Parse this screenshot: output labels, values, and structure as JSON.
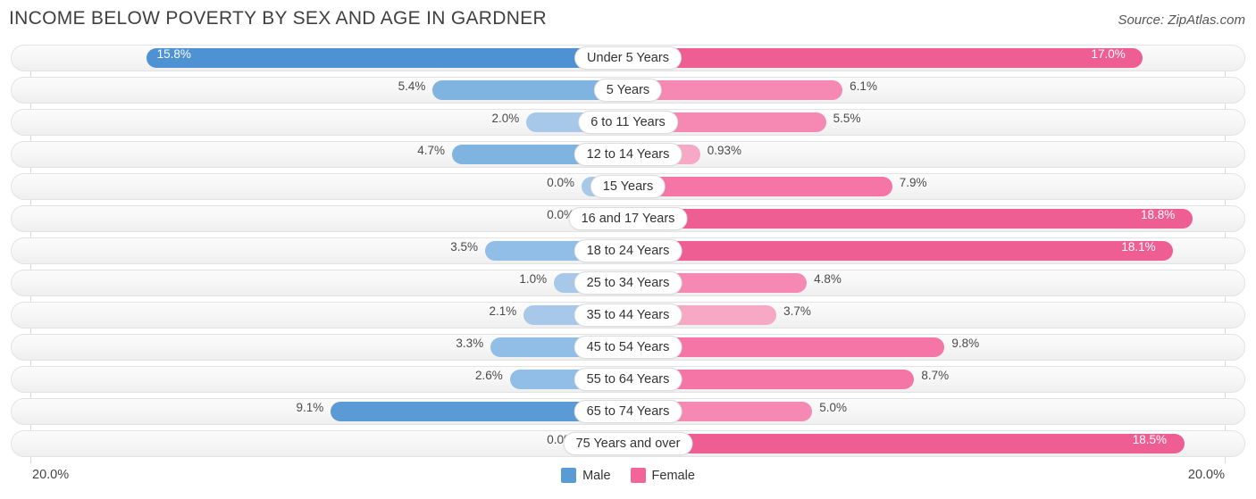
{
  "header": {
    "title": "INCOME BELOW POVERTY BY SEX AND AGE IN GARDNER",
    "source": "Source: ZipAtlas.com"
  },
  "footer": {
    "axis_left": "20.0%",
    "axis_right": "20.0%"
  },
  "legend": {
    "items": [
      {
        "label": "Male",
        "color": "#5b9bd5"
      },
      {
        "label": "Female",
        "color": "#f2649a"
      }
    ]
  },
  "chart_data": {
    "type": "bar",
    "subtype": "diverging-bar",
    "title": "INCOME BELOW POVERTY BY SEX AND AGE IN GARDNER",
    "xlabel": "",
    "ylabel": "",
    "xlim": [
      20.0,
      20.0
    ],
    "axis_max_percent": 20.0,
    "grid": false,
    "legend_position": "bottom-center",
    "categories": [
      "Under 5 Years",
      "5 Years",
      "6 to 11 Years",
      "12 to 14 Years",
      "15 Years",
      "16 and 17 Years",
      "18 to 24 Years",
      "25 to 34 Years",
      "35 to 44 Years",
      "45 to 54 Years",
      "55 to 64 Years",
      "65 to 74 Years",
      "75 Years and over"
    ],
    "series": [
      {
        "name": "Male",
        "side": "left",
        "color": "#5b9bd5",
        "values": [
          15.8,
          5.4,
          2.0,
          4.7,
          0.0,
          0.0,
          3.5,
          1.0,
          2.1,
          3.3,
          2.6,
          9.1,
          0.0
        ],
        "labels": [
          "15.8%",
          "5.4%",
          "2.0%",
          "4.7%",
          "0.0%",
          "0.0%",
          "3.5%",
          "1.0%",
          "2.1%",
          "3.3%",
          "2.6%",
          "9.1%",
          "0.0%"
        ]
      },
      {
        "name": "Female",
        "side": "right",
        "color": "#f2649a",
        "values": [
          17.0,
          6.1,
          5.5,
          0.93,
          7.9,
          18.8,
          18.1,
          4.8,
          3.7,
          9.8,
          8.7,
          5.0,
          18.5
        ],
        "labels": [
          "17.0%",
          "6.1%",
          "5.5%",
          "0.93%",
          "7.9%",
          "18.8%",
          "18.1%",
          "4.8%",
          "3.7%",
          "9.8%",
          "8.7%",
          "5.0%",
          "18.5%"
        ]
      }
    ]
  }
}
